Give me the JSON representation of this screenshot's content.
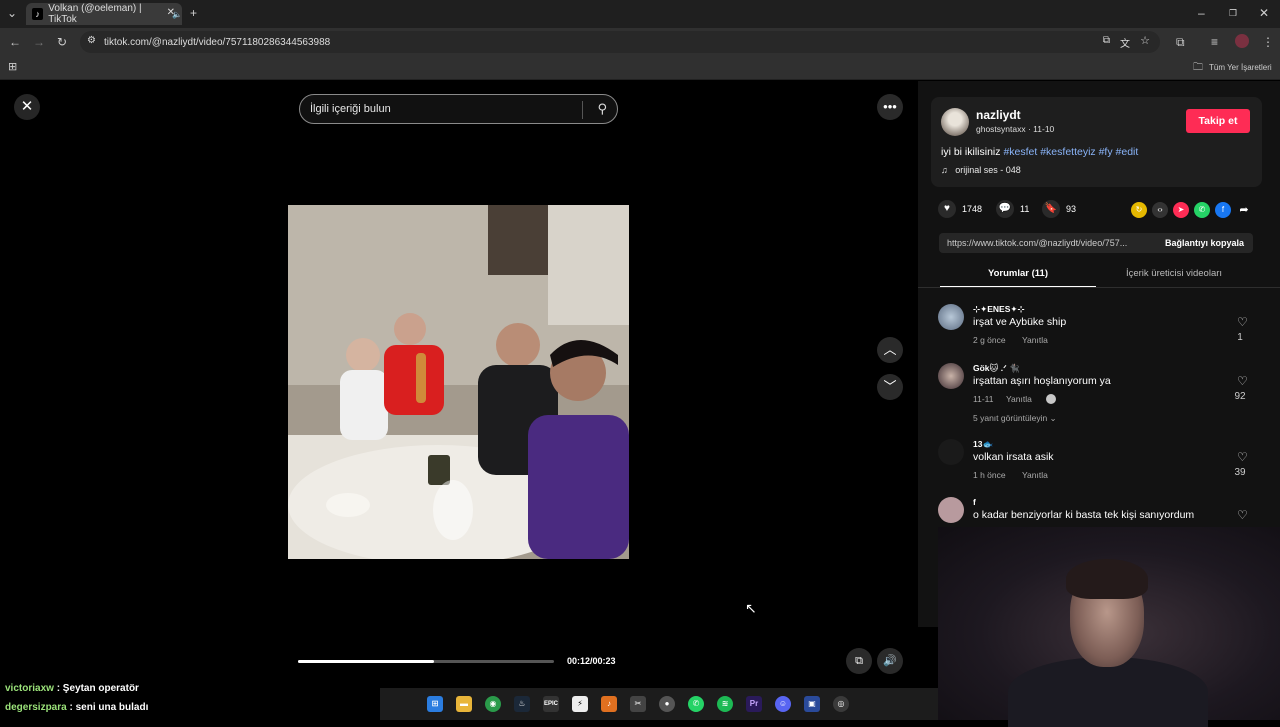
{
  "browser": {
    "tab_title": "Volkan (@oeleman) | TikTok",
    "url": "tiktok.com/@nazliydt/video/7571180286344563988",
    "bookmarks_label": "Tüm Yer İşaretleri"
  },
  "search": {
    "placeholder": "İlgili içeriği bulun"
  },
  "player": {
    "time": "00:12/00:23",
    "progress": 0.53
  },
  "post": {
    "username": "nazliydt",
    "handle_date": "ghostsyntaxx · 11-10",
    "follow_label": "Takip et",
    "caption_text": "iyi bi ikilisiniz",
    "hashtags": [
      "#kesfet",
      "#kesfetteyiz",
      "#fy",
      "#edit"
    ],
    "sound": "orijinal ses - 048",
    "likes": "1748",
    "comments": "11",
    "saves": "93",
    "link": "https://www.tiktok.com/@nazliydt/video/757...",
    "copy_label": "Bağlantıyı kopyala"
  },
  "tabs": {
    "comments": "Yorumlar (11)",
    "creator": "İçerik üreticisi videoları"
  },
  "comments": [
    {
      "user": "⊹✦ENES✦⊹",
      "text": "irşat ve Aybüke ship",
      "time": "2 g önce",
      "reply": "Yanıtla",
      "likes": "1"
    },
    {
      "user": "Gök🐱 .ᐟ 🐈‍⬛",
      "text": "irşattan aşırı hoşlanıyorum ya",
      "time": "11-11",
      "reply": "Yanıtla",
      "likes": "92",
      "view_replies": "5 yanıt görüntüleyin ⌄"
    },
    {
      "user": "13🐟",
      "text": "volkan irsata asik",
      "time": "1 h önce",
      "reply": "Yanıtla",
      "likes": "39"
    },
    {
      "user": "f",
      "text": "o kadar benziyorlar ki basta tek kişi sanıyordum",
      "time": "",
      "reply": "",
      "likes": ""
    }
  ],
  "chat": [
    {
      "user": "victoriaxw",
      "message": " : Şeytan operatör"
    },
    {
      "user": "degersizpara",
      "message": " : seni una buladı"
    }
  ]
}
